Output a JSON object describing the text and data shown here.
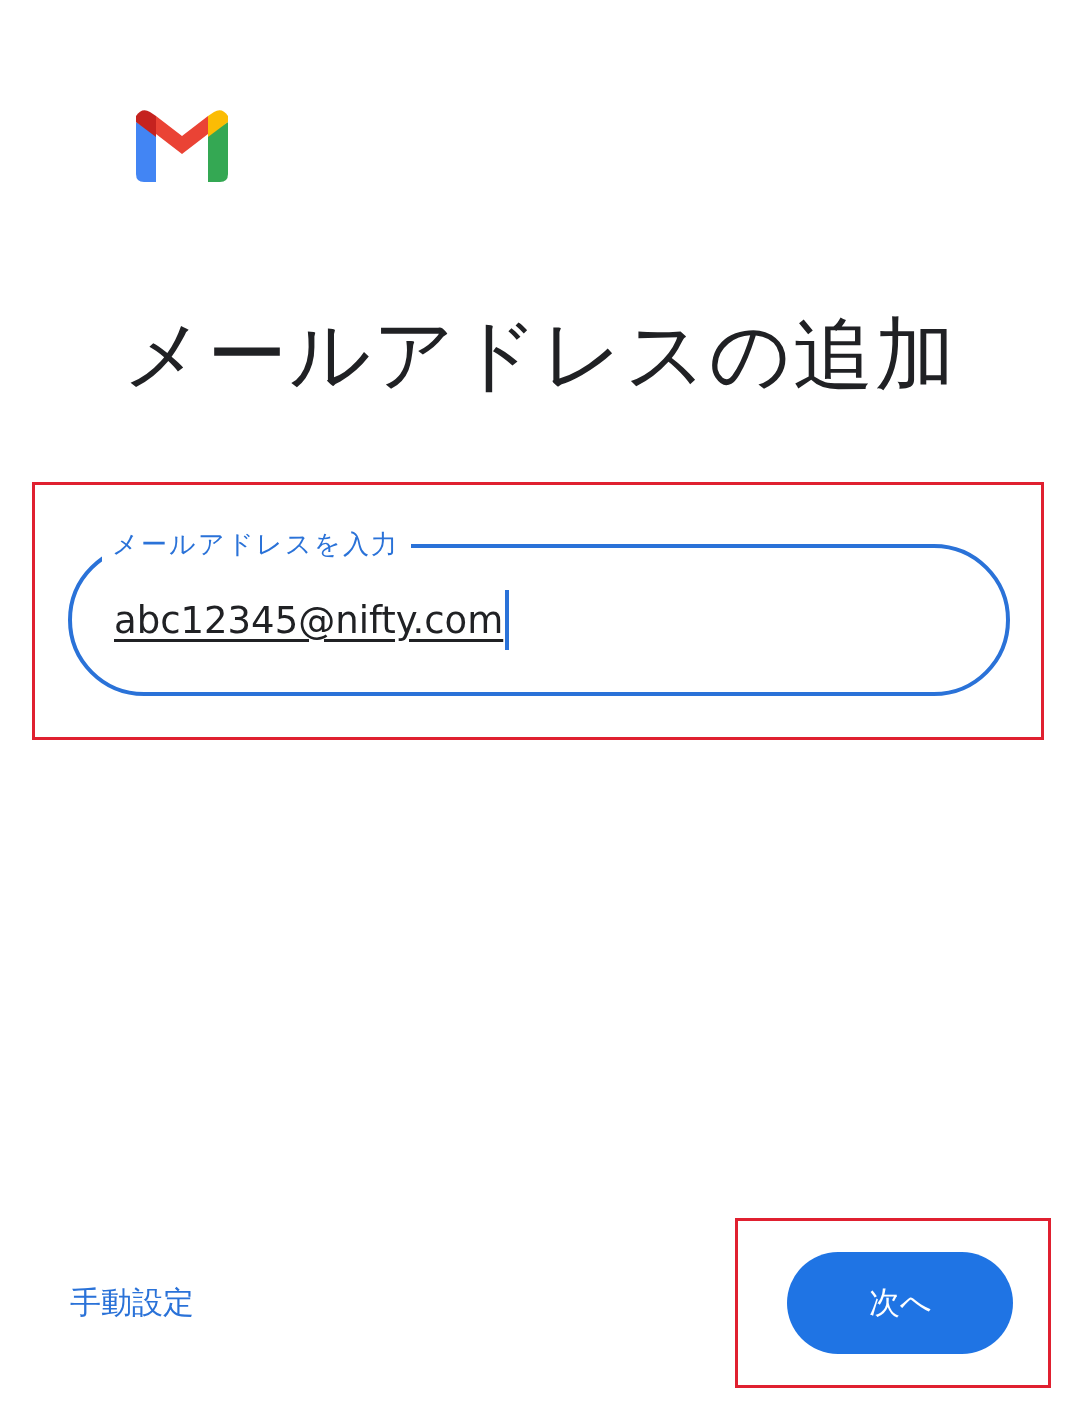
{
  "title": "メールアドレスの追加",
  "email_field": {
    "label": "メールアドレスを入力",
    "value": "abc12345@nifty.com",
    "focused": true,
    "highlighted": true
  },
  "manual_setup_link": {
    "label": "手動設定"
  },
  "next_button": {
    "label": "次へ",
    "highlighted": true
  }
}
